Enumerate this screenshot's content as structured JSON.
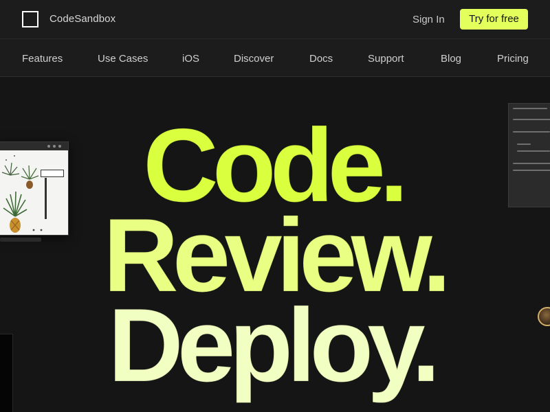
{
  "header": {
    "brand_name": "CodeSandbox",
    "sign_in_label": "Sign In",
    "try_label": "Try for free"
  },
  "nav": {
    "items": [
      {
        "label": "Features"
      },
      {
        "label": "Use Cases"
      },
      {
        "label": "iOS"
      },
      {
        "label": "Discover"
      },
      {
        "label": "Docs"
      },
      {
        "label": "Support"
      },
      {
        "label": "Blog"
      },
      {
        "label": "Pricing"
      }
    ]
  },
  "hero": {
    "line1": "Code.",
    "line2": "Review.",
    "line3": "Deploy."
  },
  "colors": {
    "background": "#151515",
    "bar_background": "#1c1c1c",
    "accent": "#e2ff5c",
    "hero_line1": "#d9ff3f",
    "hero_line2": "#e8ff83",
    "hero_line3": "#f1ffc2"
  },
  "icons": {
    "logo": "square-outline-logo-icon",
    "avatar": "user-avatar-icon"
  }
}
